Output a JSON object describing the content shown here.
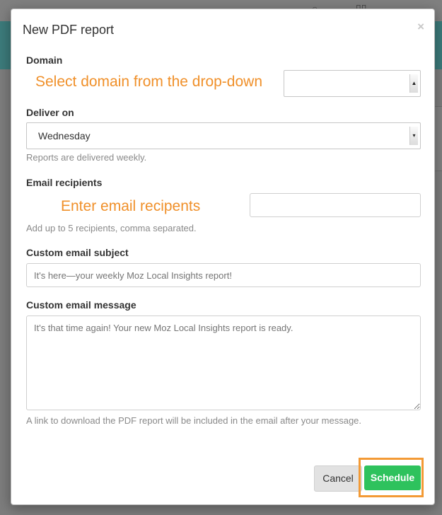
{
  "modal": {
    "title": "New PDF report",
    "close_glyph": "×"
  },
  "domain": {
    "label": "Domain",
    "selected_value": "",
    "annotation": "Select domain from the drop-down"
  },
  "deliver_on": {
    "label": "Deliver on",
    "selected_value": "Wednesday",
    "help": "Reports are delivered weekly."
  },
  "email_recipients": {
    "label": "Email recipients",
    "value": "",
    "annotation": "Enter email recipents",
    "help": "Add up to 5 recipients, comma separated."
  },
  "subject": {
    "label": "Custom email subject",
    "placeholder": "It's here—your weekly Moz Local Insights report!"
  },
  "message": {
    "label": "Custom email message",
    "placeholder": "It's that time again! Your new Moz Local Insights report is ready.",
    "help": "A link to download the PDF report will be included in the email after your message."
  },
  "buttons": {
    "cancel": "Cancel",
    "schedule": "Schedule"
  },
  "colors": {
    "accent_orange": "#f0902a",
    "schedule_green": "#2ec25d"
  }
}
